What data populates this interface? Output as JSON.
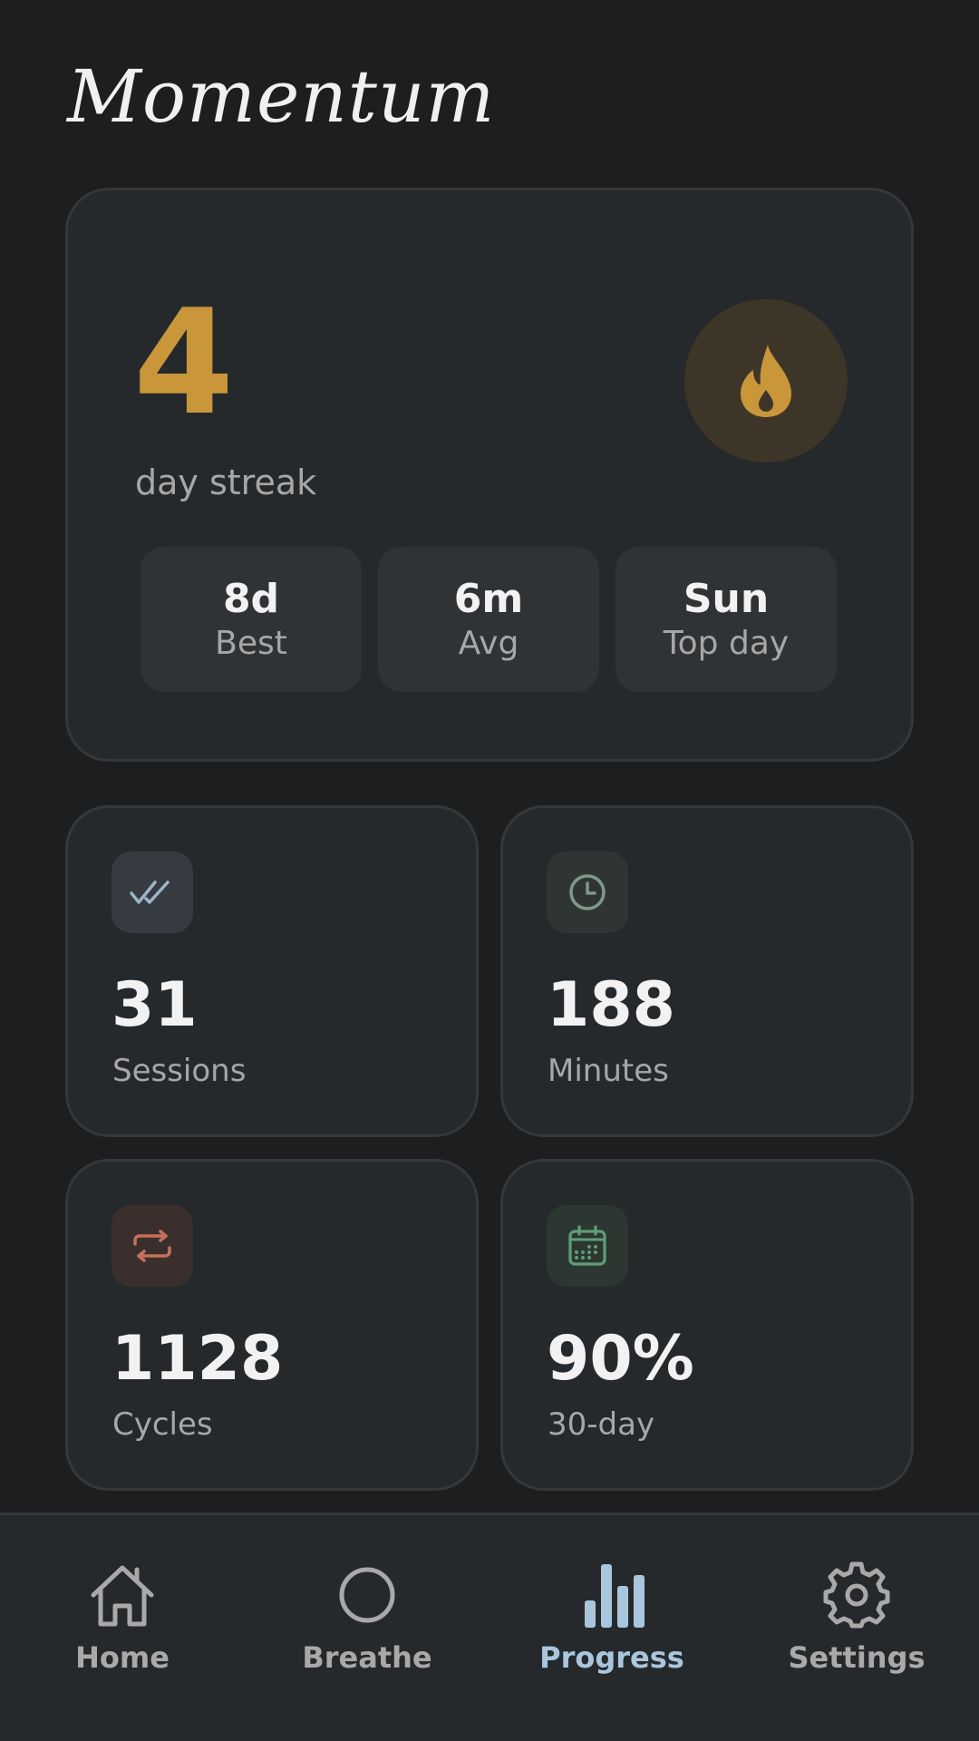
{
  "app": {
    "title": "Momentum"
  },
  "streak": {
    "value": "4",
    "label": "day streak",
    "icon": "flame-icon",
    "accent": "#c9963a",
    "mini_stats": [
      {
        "value": "8d",
        "label": "Best"
      },
      {
        "value": "6m",
        "label": "Avg"
      },
      {
        "value": "Sun",
        "label": "Top day"
      }
    ]
  },
  "stats": [
    {
      "icon": "double-check-icon",
      "value": "31",
      "label": "Sessions",
      "color": "#9bb4c6"
    },
    {
      "icon": "clock-icon",
      "value": "188",
      "label": "Minutes",
      "color": "#7f9a88"
    },
    {
      "icon": "repeat-icon",
      "value": "1128",
      "label": "Cycles",
      "color": "#c6705a"
    },
    {
      "icon": "calendar-icon",
      "value": "90%",
      "label": "30-day",
      "color": "#5f9e77"
    }
  ],
  "nav": {
    "items": [
      {
        "label": "Home",
        "icon": "home-icon"
      },
      {
        "label": "Breathe",
        "icon": "circle-icon"
      },
      {
        "label": "Progress",
        "icon": "bar-chart-icon",
        "active": true
      },
      {
        "label": "Settings",
        "icon": "gear-icon"
      }
    ],
    "active_color": "#a9c6dc"
  }
}
